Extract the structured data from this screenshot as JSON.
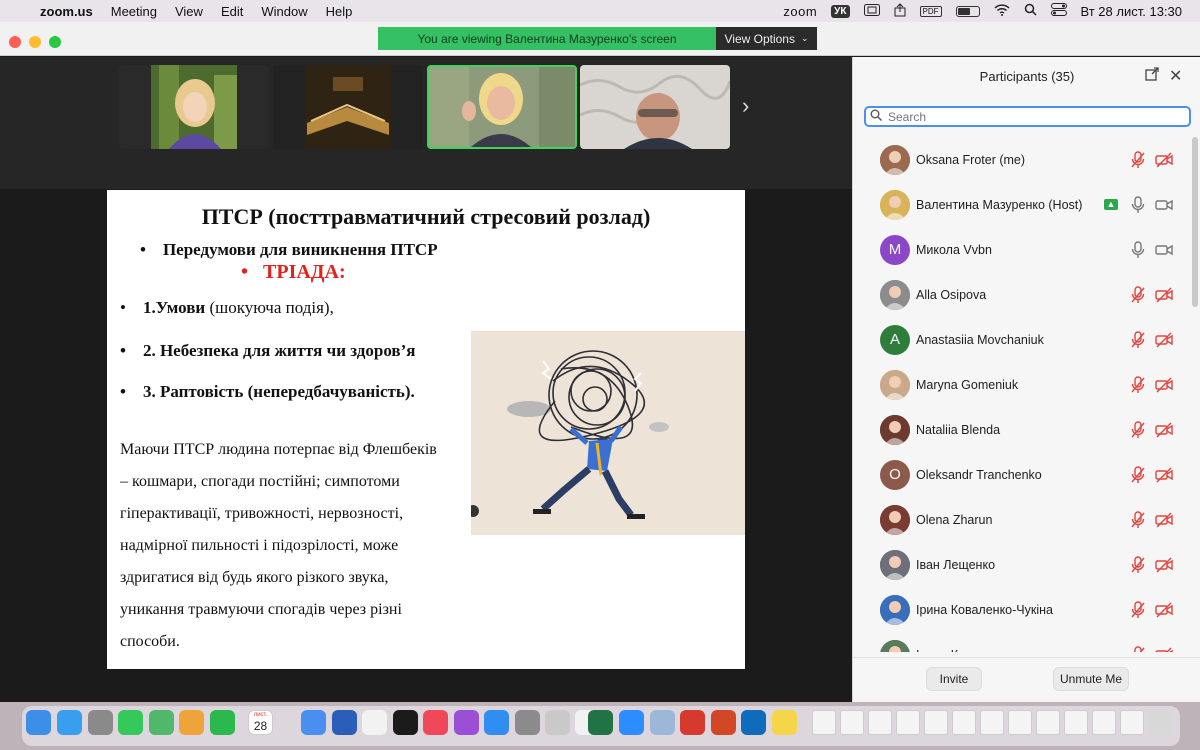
{
  "menubar": {
    "app": "zoom.us",
    "menus": [
      "Meeting",
      "View",
      "Edit",
      "Window",
      "Help"
    ],
    "zoom_label": "zoom",
    "lang": "УК",
    "pdf": "PDF",
    "datetime": "Вт 28 лист.  13:30"
  },
  "banner": {
    "viewing": "You are viewing Валентина Мазуренко's screen",
    "view_options": "View Options"
  },
  "slide": {
    "title": "ПТСР (посттравматичний стресовий розлад)",
    "bullet1": "Передумови для виникнення    ПТСР",
    "triad": "ТРІАДА:",
    "item1_bold": "1.Умови",
    "item1_rest": " (шокуюча подія),",
    "item2": "2. Небезпека для життя чи здоров’я",
    "item3": "3. Раптовість (непередбачуваність).",
    "paragraph": [
      "Маючи ПТСР людина потерпає від Флешбеків",
      "– кошмари, спогади постійні; симпотоми",
      "гіперактивації, тривожності, нервозності,",
      "надмірної пильності і підозрілості, може",
      "здригатися від будь якого різкого звука,",
      "уникання травмуючи спогадів через різні",
      "способи."
    ]
  },
  "participants": {
    "header": "Participants (35)",
    "search_placeholder": "Search",
    "list": [
      {
        "name": "Oksana Froter (me)",
        "initial": "",
        "color": "#9a6b4f"
      },
      {
        "name": "Валентина Мазуренко (Host)",
        "initial": "",
        "color": "#d9b35a"
      },
      {
        "name": "Микола Vvbn",
        "initial": "M",
        "color": "#8b47c8"
      },
      {
        "name": "Alla Osipova",
        "initial": "",
        "color": "#8c8c8c"
      },
      {
        "name": "Anastasiia Movchaniuk",
        "initial": "A",
        "color": "#2f7d3a"
      },
      {
        "name": "Maryna Gomeniuk",
        "initial": "",
        "color": "#caa98a"
      },
      {
        "name": "Nataliia Blenda",
        "initial": "",
        "color": "#6d3b2e"
      },
      {
        "name": "Oleksandr Tranchenko",
        "initial": "O",
        "color": "#8b5a4a"
      },
      {
        "name": "Olena Zharun",
        "initial": "",
        "color": "#7a3b30"
      },
      {
        "name": "Іван Лещенко",
        "initial": "",
        "color": "#6f6f7a"
      },
      {
        "name": "Ірина Коваленко-Чукіна",
        "initial": "",
        "color": "#3b6dbd"
      },
      {
        "name": "Ірина Коваленко",
        "initial": "",
        "color": "#5b7a5b"
      }
    ],
    "invite": "Invite",
    "unmute": "Unmute Me"
  },
  "dock": {
    "calendar_month": "лист.",
    "calendar_day": "28"
  }
}
